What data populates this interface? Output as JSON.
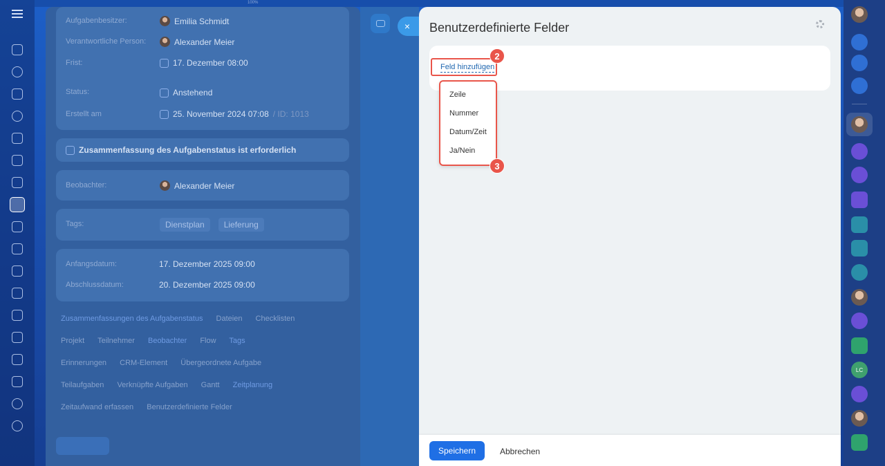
{
  "top_strip": {
    "zoom": "100%"
  },
  "task_page": {
    "fields": [
      {
        "label": "Aufgabenbesitzer:",
        "value": "Emilia Schmidt"
      },
      {
        "label": "Verantwortliche Person:",
        "value": "Alexander Meier"
      },
      {
        "label": "Frist:",
        "value": "17. Dezember 08:00"
      },
      {
        "label": "Status:",
        "value": "Anstehend"
      },
      {
        "label": "Erstellt am",
        "value": "25. November 2024 07:08",
        "suffix": "/ ID: 1013"
      }
    ],
    "summary_title": "Zusammenfassung des Aufgabenstatus ist erforderlich",
    "observer": {
      "label": "Beobachter:",
      "value": "Alexander Meier"
    },
    "tags": {
      "label": "Tags:",
      "items": [
        "Dienstplan",
        "Lieferung"
      ]
    },
    "dates": [
      {
        "label": "Anfangsdatum:",
        "value": "17. Dezember 2025 09:00"
      },
      {
        "label": "Abschlussdatum:",
        "value": "20. Dezember 2025 09:00"
      }
    ],
    "tab_rows": [
      [
        "Zusammenfassungen des Aufgabenstatus",
        "Dateien",
        "Checklisten"
      ],
      [
        "Projekt",
        "Teilnehmer",
        "Beobachter",
        "Flow",
        "Tags"
      ],
      [
        "Erinnerungen",
        "CRM-Element",
        "Übergeordnete Aufgabe"
      ],
      [
        "Teilaufgaben",
        "Verknüpfte Aufgaben",
        "Gantt",
        "Zeitplanung"
      ],
      [
        "Zeitaufwand erfassen",
        "Benutzerdefinierte Felder"
      ]
    ]
  },
  "panel": {
    "title": "Benutzerdefinierte Felder",
    "add_field_link": "Feld hinzufügen",
    "dropdown_options": [
      "Zeile",
      "Nummer",
      "Datum/Zeit",
      "Ja/Nein"
    ],
    "badges": [
      "2",
      "3"
    ],
    "save_label": "Speichern",
    "cancel_label": "Abbrechen"
  },
  "close_glyph": "×",
  "right_bar": {
    "lc_label": "LC"
  },
  "colors": {
    "accent": "#1f6fe5",
    "highlight": "#e9554a",
    "link": "#2067b0"
  }
}
